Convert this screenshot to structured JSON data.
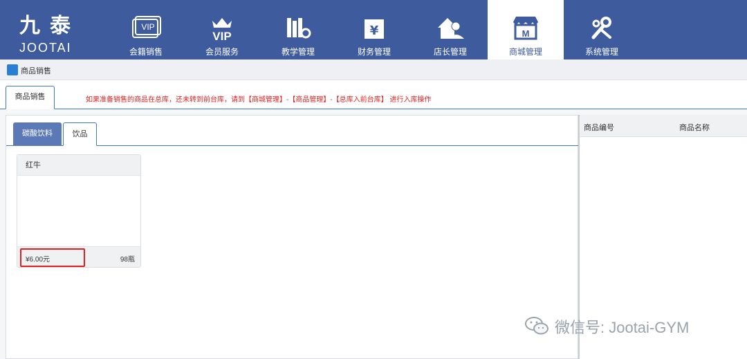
{
  "brand": {
    "cn": "九泰",
    "en": "JOOTAI"
  },
  "nav": [
    {
      "label": "会籍销售",
      "icon": "vip-card-icon"
    },
    {
      "label": "会员服务",
      "icon": "vip-crown-icon"
    },
    {
      "label": "教学管理",
      "icon": "books-gear-icon"
    },
    {
      "label": "财务管理",
      "icon": "yen-ledger-icon"
    },
    {
      "label": "店长管理",
      "icon": "manager-house-icon"
    },
    {
      "label": "商城管理",
      "icon": "store-icon",
      "active": true
    },
    {
      "label": "系统管理",
      "icon": "wrench-gear-icon"
    }
  ],
  "breadcrumb": {
    "label": "商品销售"
  },
  "page_tab": {
    "label": "商品销售"
  },
  "notice": "如果准备销售的商品在总库，还未转到前台库，请到【商城管理】-【商品管理】-【总库入前台库】 进行入库操作",
  "categories": [
    {
      "label": "碳酸饮料",
      "active": false
    },
    {
      "label": "饮品",
      "active": true
    }
  ],
  "products": [
    {
      "name": "红牛",
      "price": "¥6.00元",
      "stock": "98瓶",
      "highlighted": true
    }
  ],
  "cart_table": {
    "columns": [
      "商品编号",
      "商品名称"
    ]
  },
  "watermark": "微信号: Jootai-GYM",
  "colors": {
    "header_bg": "#3d5b9d",
    "accent": "#3d78c4",
    "highlight": "#e02020"
  }
}
